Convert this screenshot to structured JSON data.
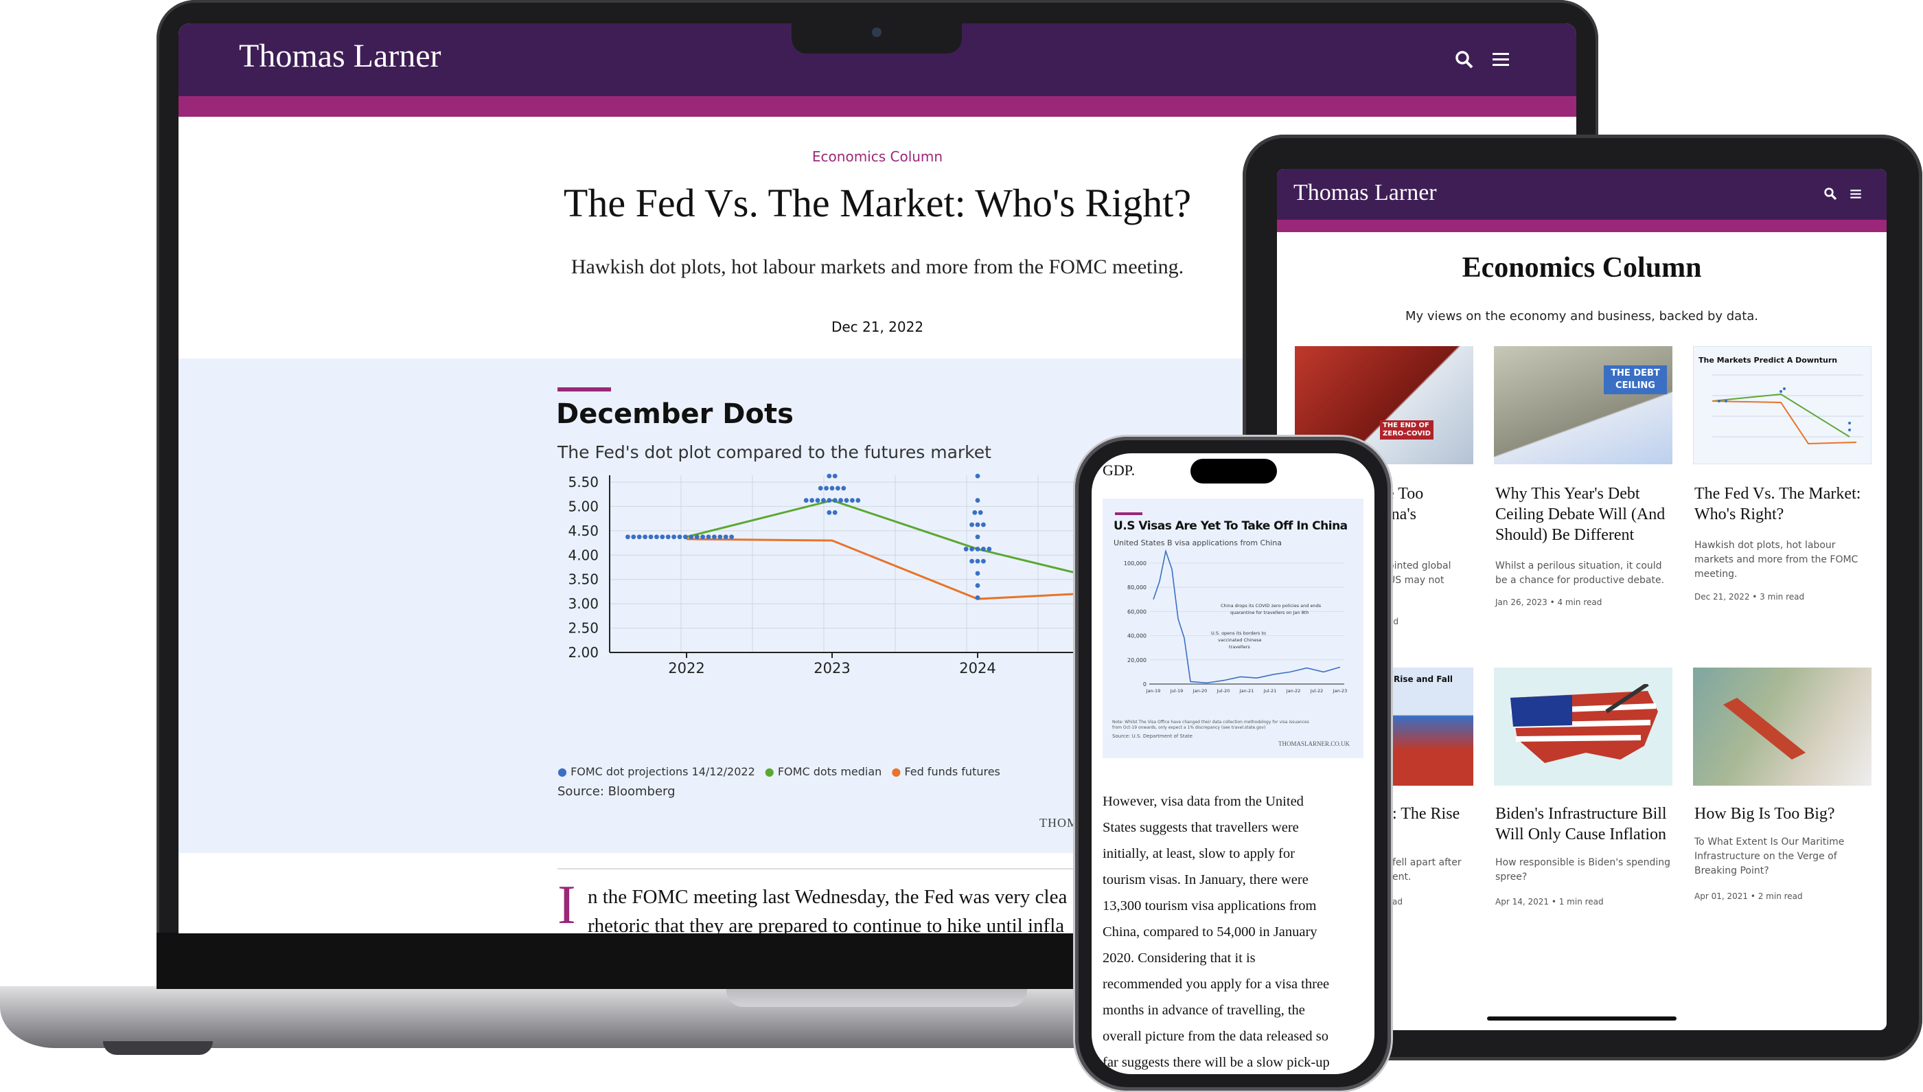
{
  "site": {
    "logo": "Thomas Larner"
  },
  "laptop": {
    "category": "Economics Column",
    "title": "The Fed Vs. The Market: Who's Right?",
    "subtitle": "Hawkish dot plots, hot labour markets and more from the FOMC meeting.",
    "date": "Dec 21, 2022",
    "body_dropcap": "I",
    "body_line1": "n the FOMC meeting last Wednesday, the Fed was very clea",
    "body_line2": "rhetoric that they are prepared to continue to hike until infla",
    "chart_source": "Source: Bloomberg",
    "chart_watermark": "THOM"
  },
  "chart_data": [
    {
      "type": "line",
      "title": "December Dots",
      "subtitle": "The Fed's dot plot compared to the futures market",
      "x": [
        "2022",
        "2023",
        "2024"
      ],
      "ylim": [
        2.0,
        5.5
      ],
      "yticks": [
        "5.50",
        "5.00",
        "4.50",
        "4.00",
        "3.50",
        "3.00",
        "2.50",
        "2.00"
      ],
      "legend_position": "bottom-left",
      "grid": true,
      "series": [
        {
          "name": "FOMC dot projections 14/12/2022",
          "color": "#3a6fc4",
          "kind": "dots",
          "points": [
            {
              "x": "2022",
              "y": 4.375,
              "count": 19
            },
            {
              "x": "2023",
              "y": 5.625,
              "count": 2
            },
            {
              "x": "2023",
              "y": 5.375,
              "count": 5
            },
            {
              "x": "2023",
              "y": 5.125,
              "count": 10
            },
            {
              "x": "2023",
              "y": 4.875,
              "count": 2
            },
            {
              "x": "2024",
              "y": 5.625,
              "count": 1
            },
            {
              "x": "2024",
              "y": 5.125,
              "count": 1
            },
            {
              "x": "2024",
              "y": 4.875,
              "count": 2
            },
            {
              "x": "2024",
              "y": 4.625,
              "count": 3
            },
            {
              "x": "2024",
              "y": 4.375,
              "count": 1
            },
            {
              "x": "2024",
              "y": 4.125,
              "count": 5
            },
            {
              "x": "2024",
              "y": 3.875,
              "count": 3
            },
            {
              "x": "2024",
              "y": 3.625,
              "count": 1
            },
            {
              "x": "2024",
              "y": 3.375,
              "count": 1
            },
            {
              "x": "2024",
              "y": 3.125,
              "count": 1
            }
          ]
        },
        {
          "name": "FOMC dots median",
          "color": "#5aa832",
          "values": [
            4.375,
            5.125,
            4.125,
            3.4
          ]
        },
        {
          "name": "Fed funds futures",
          "color": "#e8732a",
          "values": [
            4.33,
            4.3,
            3.1,
            3.25
          ]
        }
      ]
    },
    {
      "type": "line",
      "title": "U.S Visas Are Yet To Take Off In China",
      "subtitle": "United States B visa applications from China",
      "yticks": [
        "100,000",
        "80,000",
        "60,000",
        "40,000",
        "20,000",
        "0"
      ],
      "x": [
        "Jan-19",
        "Jul-19",
        "Jan-20",
        "Jul-20",
        "Jan-21",
        "Jul-21",
        "Jan-22",
        "Jul-22",
        "Jan-23"
      ],
      "annotations": [
        "China drops its COVID zero policies and ends quarantine for travellers on Jan 8th",
        "U.S. opens its borders to vaccinated Chinese travellers"
      ],
      "series": [
        {
          "name": "B visa applications",
          "color": "#3a6fc4",
          "values": [
            70000,
            85000,
            110000,
            95000,
            54000,
            38000,
            2000,
            1000,
            3000,
            6000,
            5000,
            8000,
            10000,
            13300,
            10000,
            14000
          ]
        }
      ],
      "note": "Note: Whilst The Visa Office have changed their data collection methodology for visa issuances from Oct-19 onwards, only expect a 1% discrepancy (see travel.state.gov)",
      "source": "Source: U.S. Department of State",
      "watermark": "THOMASLARNER.CO.UK"
    }
  ],
  "tablet": {
    "page_title": "Economics Column",
    "page_desc": "My views on the economy and business, backed by data.",
    "cards": [
      {
        "image_caption": "THE END OF ZERO-COVID",
        "title_l1": "e Too",
        "title_l2": "ina's",
        "desc_l1": "ointed global",
        "desc_l2": "US may not",
        "meta": "ad"
      },
      {
        "image_caption": "THE DEBT CEILING",
        "title_l1": "Why This Year's Debt",
        "title_l2": "Ceiling Debate Will (And",
        "title_l3": "Should) Be Different",
        "desc_l1": "Whilst a perilous situation, it could",
        "desc_l2": "be a chance for productive debate.",
        "meta": "Jan 26, 2023 • 4 min read"
      },
      {
        "image_caption": "The Markets Predict A Downturn",
        "title_l1": "The Fed Vs. The Market:",
        "title_l2": "Who's Right?",
        "desc_l1": "Hawkish dot plots, hot labour",
        "desc_l2": "markets and more from the FOMC",
        "desc_l3": "meeting.",
        "meta": "Dec 21, 2022 • 3 min read"
      },
      {
        "image_caption": "Rise and Fall",
        "title_l1": ": The Rise",
        "desc_l1": "fell apart after",
        "desc_l2": "ent.",
        "meta": "ad"
      },
      {
        "title_l1": "Biden's Infrastructure Bill",
        "title_l2": "Will Only Cause Inflation",
        "desc_l1": "How responsible is Biden's spending",
        "desc_l2": "spree?",
        "meta": "Apr 14, 2021 • 1 min read"
      },
      {
        "title_l1": "How Big Is Too Big?",
        "desc_l1": "To What Extent Is Our Maritime",
        "desc_l2": "Infrastructure on the Verge of",
        "desc_l3": "Breaking Point?",
        "meta": "Apr 01, 2021 • 2 min read"
      }
    ]
  },
  "phone": {
    "top_text": "GDP.",
    "paragraph": [
      "However, visa data from the United",
      "States suggests that travellers were",
      "initially, at least, slow to apply for",
      "tourism visas. In January, there were",
      "13,300 tourism visa applications from",
      "China, compared to 54,000 in January",
      "2020. Considering that it is",
      "recommended you apply for a visa three",
      "months in advance of travelling, the",
      "overall picture from the data released so",
      "far suggests there will be a slow pick-up"
    ]
  },
  "colors": {
    "brand_purple": "#3f1e55",
    "brand_magenta": "#9b2778",
    "chart_bg": "#eaf1fc"
  }
}
